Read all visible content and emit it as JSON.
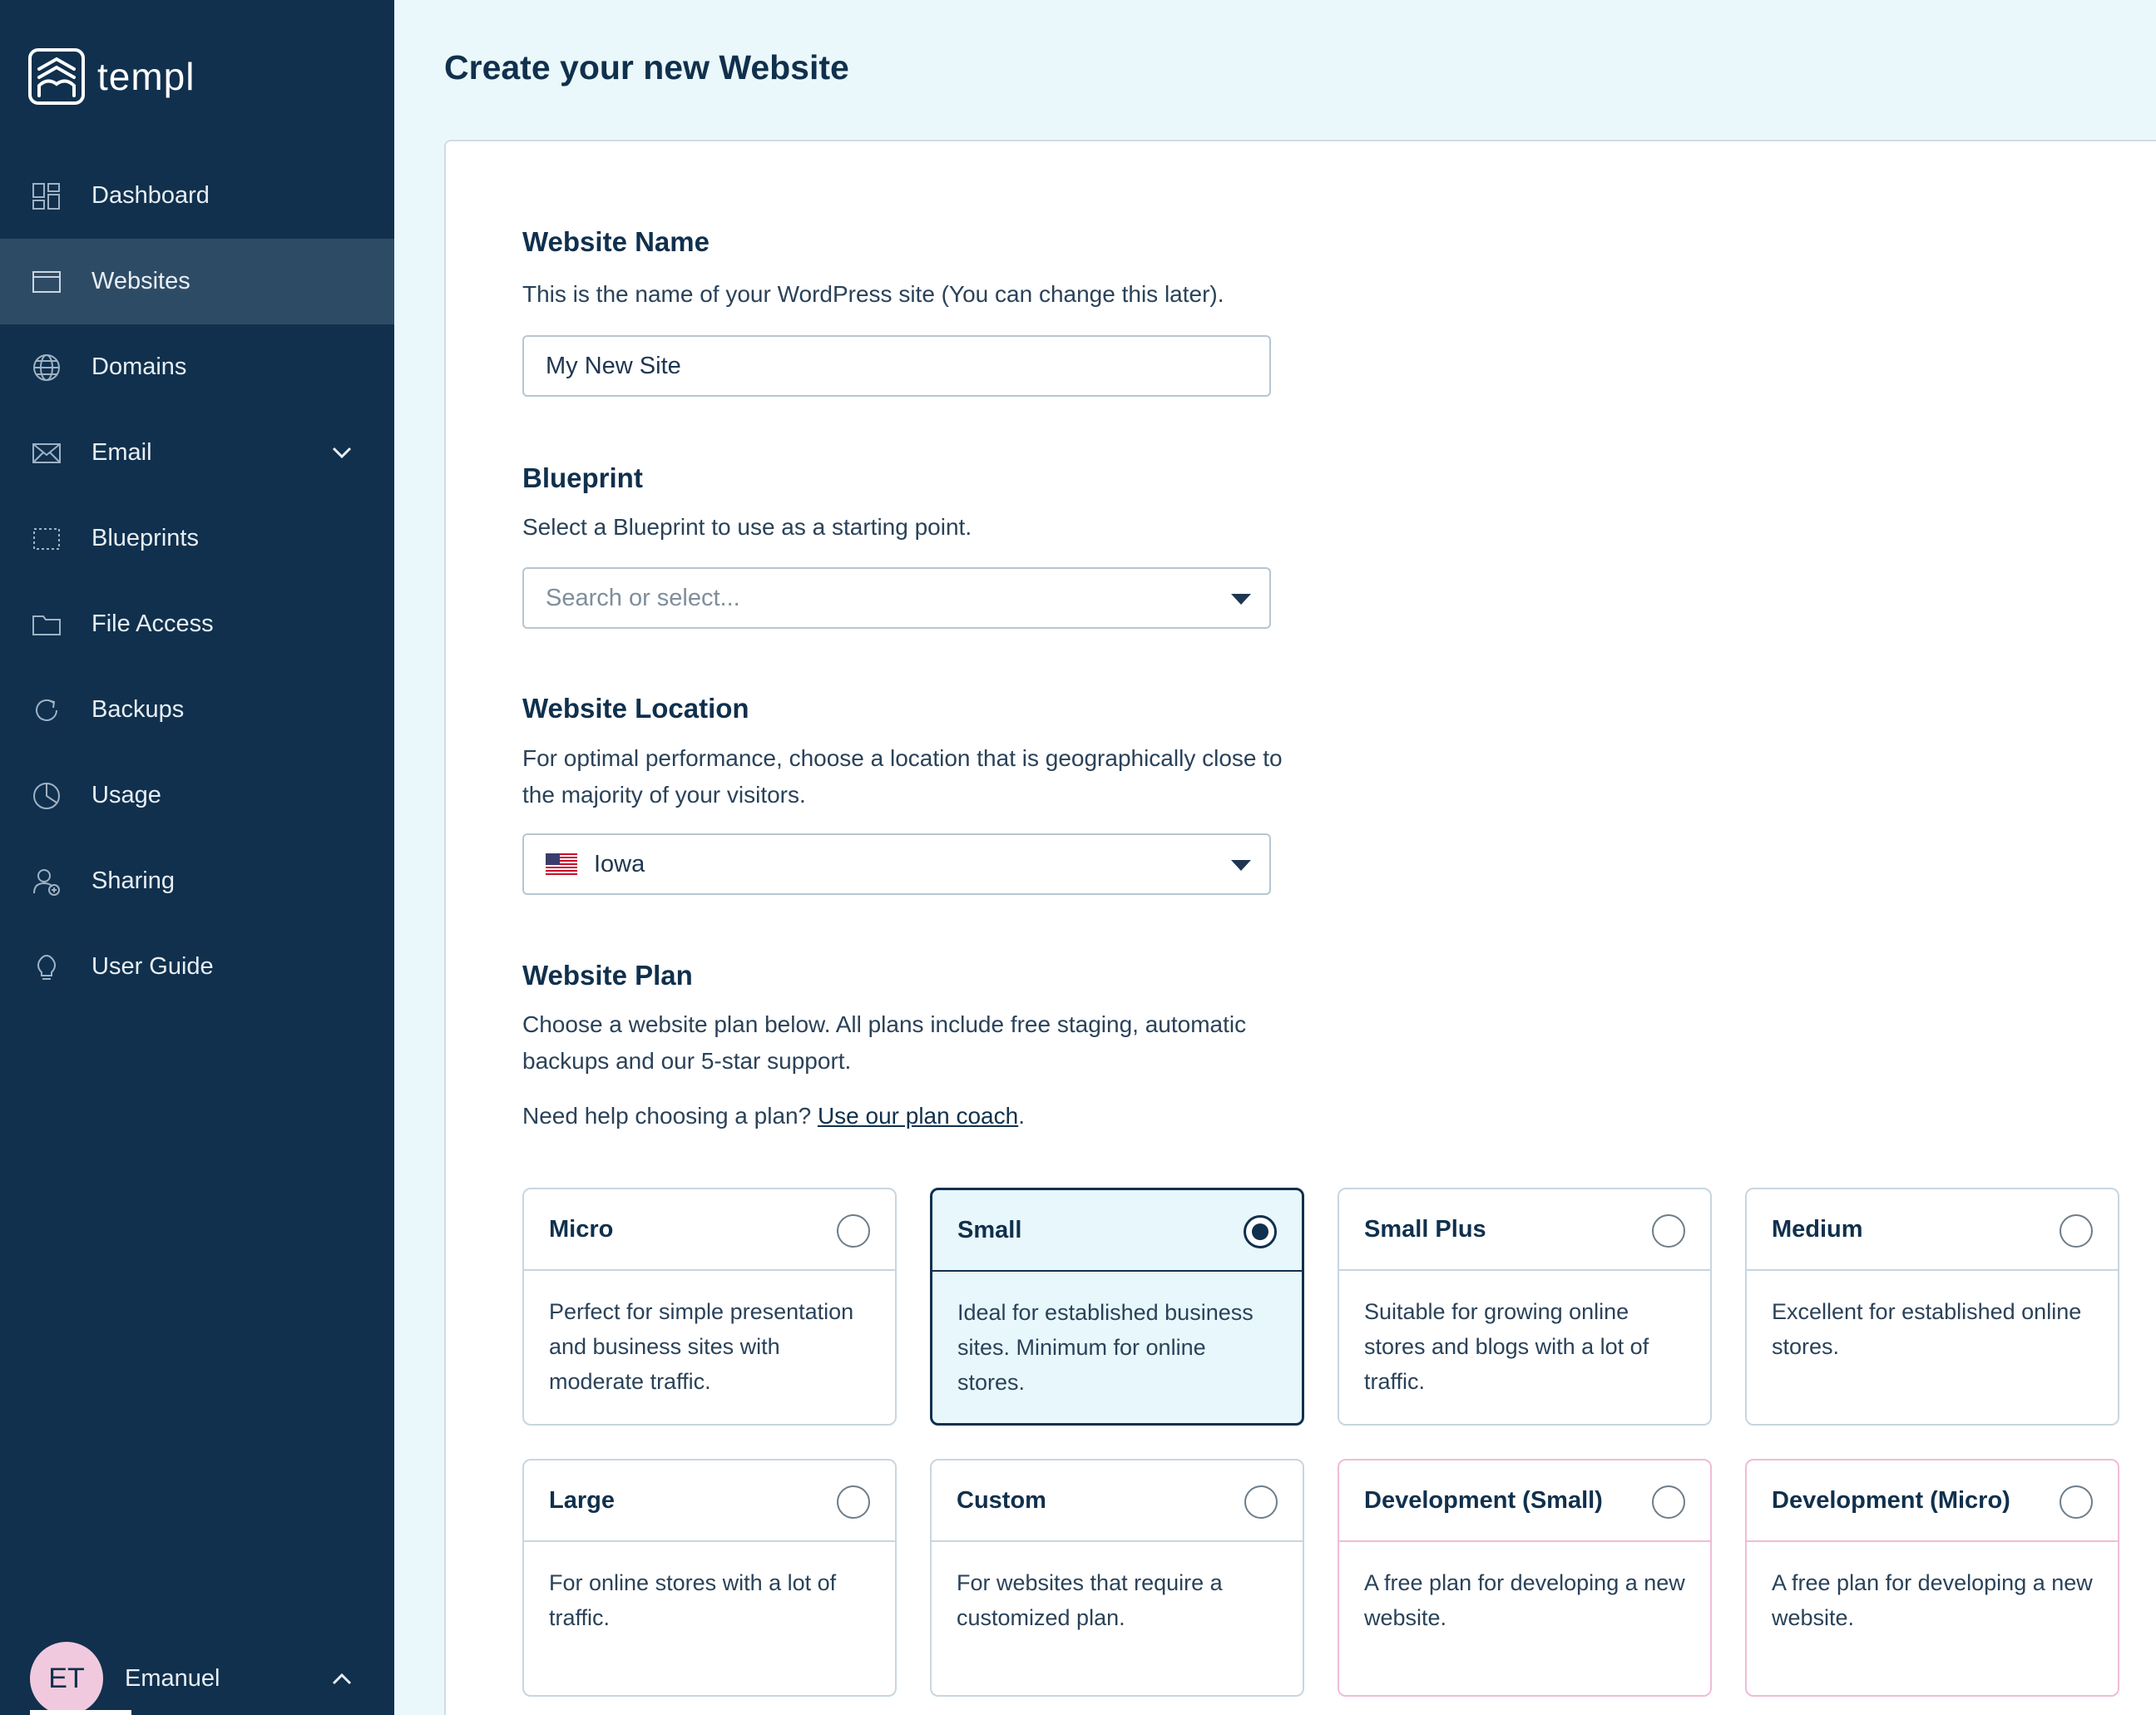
{
  "brand": {
    "name": "templ"
  },
  "sidebar": {
    "items": [
      {
        "label": "Dashboard",
        "icon": "dashboard-icon"
      },
      {
        "label": "Websites",
        "icon": "browser-window-icon",
        "active": true
      },
      {
        "label": "Domains",
        "icon": "globe-icon"
      },
      {
        "label": "Email",
        "icon": "envelope-icon",
        "expandable": true
      },
      {
        "label": "Blueprints",
        "icon": "blueprint-icon"
      },
      {
        "label": "File Access",
        "icon": "folder-icon"
      },
      {
        "label": "Backups",
        "icon": "refresh-icon"
      },
      {
        "label": "Usage",
        "icon": "pie-chart-icon"
      },
      {
        "label": "Sharing",
        "icon": "user-share-icon"
      },
      {
        "label": "User Guide",
        "icon": "lightbulb-icon"
      }
    ],
    "user": {
      "initials": "ET",
      "name": "Emanuel"
    }
  },
  "page": {
    "title": "Create your new Website"
  },
  "form": {
    "website_name": {
      "title": "Website Name",
      "description": "This is the name of your WordPress site (You can change this later).",
      "value": "My New Site"
    },
    "blueprint": {
      "title": "Blueprint",
      "description": "Select a Blueprint to use as a starting point.",
      "placeholder": "Search or select..."
    },
    "location": {
      "title": "Website Location",
      "description": "For optimal performance, choose a location that is geographically close to the majority of your visitors.",
      "value": "Iowa",
      "flag": "us-flag-icon"
    },
    "plan": {
      "title": "Website Plan",
      "description": "Choose a website plan below. All plans include free staging, automatic backups and our 5-star support.",
      "help_prefix": "Need help choosing a plan?",
      "help_link": "Use our plan coach",
      "help_suffix": ".",
      "selected": "Small",
      "options": [
        {
          "name": "Micro",
          "description": "Perfect for simple presentation and business sites with moderate traffic."
        },
        {
          "name": "Small",
          "description": "Ideal for established business sites. Minimum for online stores."
        },
        {
          "name": "Small Plus",
          "description": "Suitable for growing online stores and blogs with a lot of traffic."
        },
        {
          "name": "Medium",
          "description": "Excellent for established online stores."
        },
        {
          "name": "Large",
          "description": "For online stores with a lot of traffic."
        },
        {
          "name": "Custom",
          "description": "For websites that require a customized plan."
        },
        {
          "name": "Development (Small)",
          "description": "A free plan for developing a new website."
        },
        {
          "name": "Development (Micro)",
          "description": "A free plan for developing a new website."
        }
      ]
    }
  },
  "colors": {
    "sidebar_bg": "#10304d",
    "sidebar_active": "#2e4b66",
    "page_bg": "#eaf8fb",
    "selected_plan_bg": "#e8f7fb",
    "dev_plan_border": "#f0bcd6",
    "avatar_bg": "#f0c9de"
  }
}
